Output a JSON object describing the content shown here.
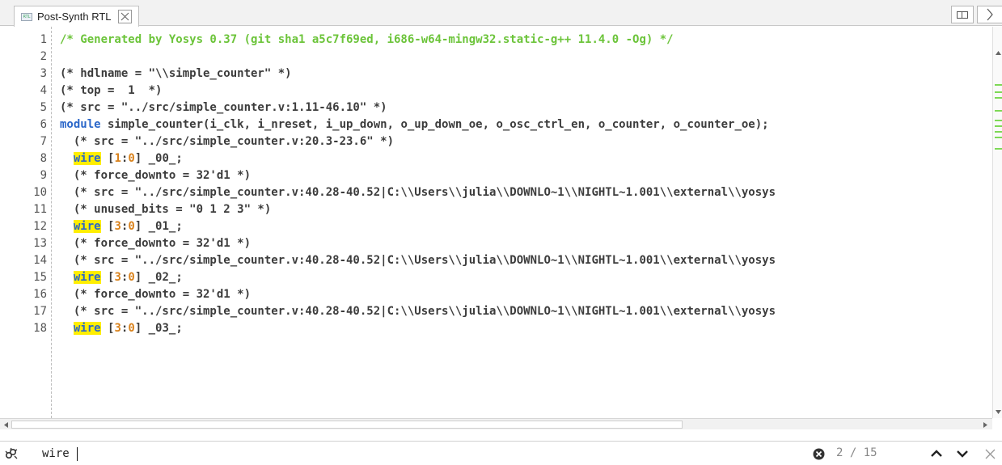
{
  "tab": {
    "icon": "rtl-file-icon",
    "title": "Post-Synth RTL"
  },
  "editor": {
    "lines": [
      {
        "num": "1",
        "segments": [
          {
            "t": "/* Generated by Yosys 0.37 (git sha1 a5c7f69ed, i686-w64-mingw32.static-g++ 11.4.0 -Og) */",
            "c": "comment"
          }
        ]
      },
      {
        "num": "2",
        "segments": []
      },
      {
        "num": "3",
        "segments": [
          {
            "t": "(* hdlname = \"\\\\simple_counter\" *)",
            "c": "plain"
          }
        ]
      },
      {
        "num": "4",
        "segments": [
          {
            "t": "(* top =  1  *)",
            "c": "plain"
          }
        ]
      },
      {
        "num": "5",
        "segments": [
          {
            "t": "(* src = \"../src/simple_counter.v:1.11-46.10\" *)",
            "c": "plain"
          }
        ]
      },
      {
        "num": "6",
        "segments": [
          {
            "t": "module",
            "c": "kw"
          },
          {
            "t": " simple_counter(i_clk, i_nreset, i_up_down, o_up_down_oe, o_osc_ctrl_en, o_counter, o_counter_oe);",
            "c": "plain"
          }
        ]
      },
      {
        "num": "7",
        "segments": [
          {
            "t": "  (* src = \"../src/simple_counter.v:20.3-23.6\" *)",
            "c": "plain"
          }
        ]
      },
      {
        "num": "8",
        "segments": [
          {
            "t": "  ",
            "c": "plain"
          },
          {
            "t": "wire",
            "c": "hl"
          },
          {
            "t": " [",
            "c": "plain"
          },
          {
            "t": "1",
            "c": "num"
          },
          {
            "t": ":",
            "c": "plain"
          },
          {
            "t": "0",
            "c": "num"
          },
          {
            "t": "] _00_;",
            "c": "plain"
          }
        ]
      },
      {
        "num": "9",
        "segments": [
          {
            "t": "  (* force_downto = 32'd1 *)",
            "c": "plain"
          }
        ]
      },
      {
        "num": "10",
        "segments": [
          {
            "t": "  (* src = \"../src/simple_counter.v:40.28-40.52|C:\\\\Users\\\\julia\\\\DOWNLO~1\\\\NIGHTL~1.001\\\\external\\\\yosys",
            "c": "plain"
          }
        ]
      },
      {
        "num": "11",
        "segments": [
          {
            "t": "  (* unused_bits = \"0 1 2 3\" *)",
            "c": "plain"
          }
        ]
      },
      {
        "num": "12",
        "segments": [
          {
            "t": "  ",
            "c": "plain"
          },
          {
            "t": "wire",
            "c": "hl"
          },
          {
            "t": " [",
            "c": "plain"
          },
          {
            "t": "3",
            "c": "num"
          },
          {
            "t": ":",
            "c": "plain"
          },
          {
            "t": "0",
            "c": "num"
          },
          {
            "t": "] _01_;",
            "c": "plain"
          }
        ]
      },
      {
        "num": "13",
        "segments": [
          {
            "t": "  (* force_downto = 32'd1 *)",
            "c": "plain"
          }
        ]
      },
      {
        "num": "14",
        "segments": [
          {
            "t": "  (* src = \"../src/simple_counter.v:40.28-40.52|C:\\\\Users\\\\julia\\\\DOWNLO~1\\\\NIGHTL~1.001\\\\external\\\\yosys",
            "c": "plain"
          }
        ]
      },
      {
        "num": "15",
        "segments": [
          {
            "t": "  ",
            "c": "plain"
          },
          {
            "t": "wire",
            "c": "hl"
          },
          {
            "t": " [",
            "c": "plain"
          },
          {
            "t": "3",
            "c": "num"
          },
          {
            "t": ":",
            "c": "plain"
          },
          {
            "t": "0",
            "c": "num"
          },
          {
            "t": "] _02_;",
            "c": "plain"
          }
        ]
      },
      {
        "num": "16",
        "segments": [
          {
            "t": "  (* force_downto = 32'd1 *)",
            "c": "plain"
          }
        ]
      },
      {
        "num": "17",
        "segments": [
          {
            "t": "  (* src = \"../src/simple_counter.v:40.28-40.52|C:\\\\Users\\\\julia\\\\DOWNLO~1\\\\NIGHTL~1.001\\\\external\\\\yosys",
            "c": "plain"
          }
        ]
      },
      {
        "num": "18",
        "segments": [
          {
            "t": "  ",
            "c": "plain"
          },
          {
            "t": "wire",
            "c": "hl"
          },
          {
            "t": " [",
            "c": "plain"
          },
          {
            "t": "3",
            "c": "num"
          },
          {
            "t": ":",
            "c": "plain"
          },
          {
            "t": "0",
            "c": "num"
          },
          {
            "t": "] _03_;",
            "c": "plain"
          }
        ]
      }
    ]
  },
  "search": {
    "icon": "find-icon",
    "value": "wire",
    "result_count": "2 / 15"
  },
  "colors": {
    "comment": "#6cc43a",
    "keyword": "#2b67c9",
    "number": "#d9821c",
    "highlight": "#ffee00"
  }
}
